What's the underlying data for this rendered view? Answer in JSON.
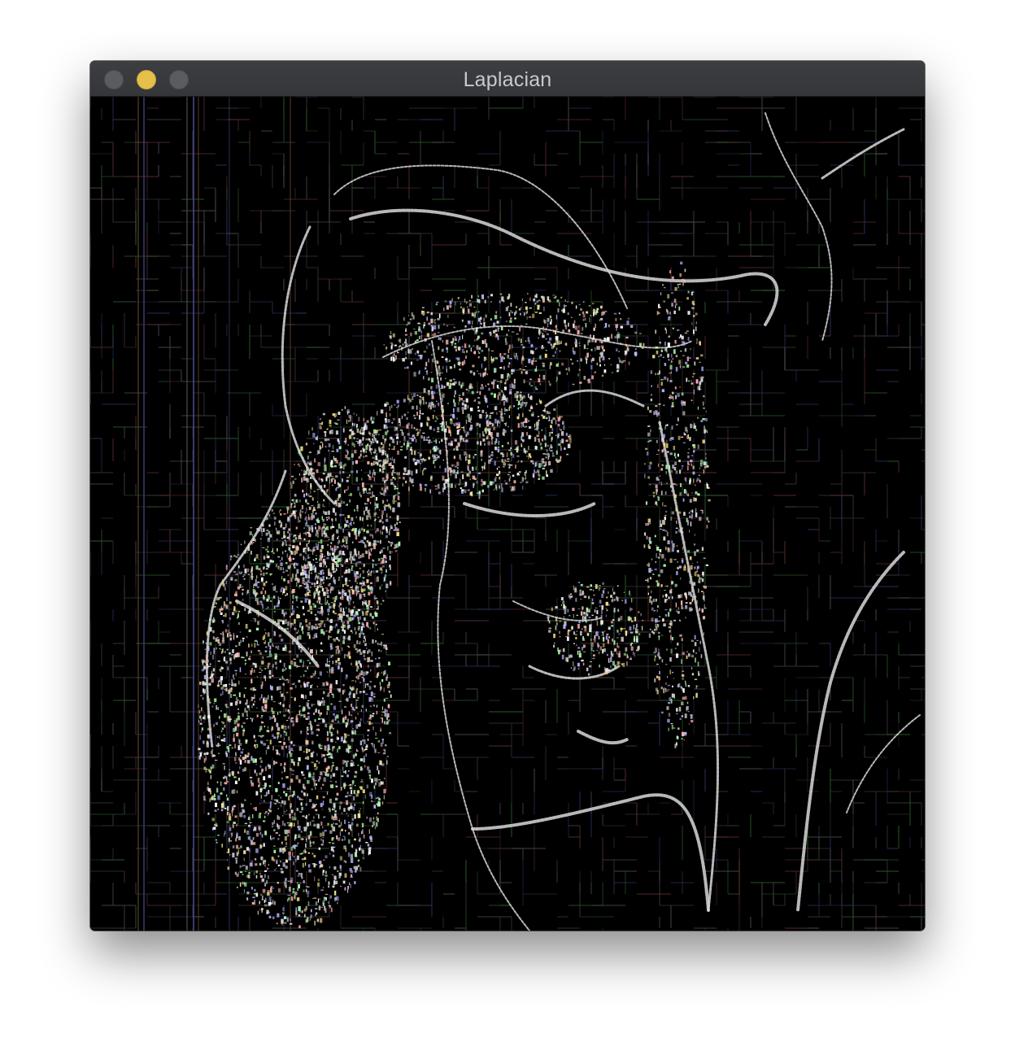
{
  "window": {
    "title": "Laplacian",
    "buttons": {
      "close": "close-button",
      "minimize": "minimize-button",
      "zoom": "zoom-button"
    },
    "colors": {
      "titlebar": "#3a3b3e",
      "minimize": "#e5c04a",
      "inactive_button": "#5b5c5f",
      "title_text": "#c9c9cc"
    }
  },
  "image": {
    "description_tag": "laplacian-edge-filtered-image",
    "background": "#000000"
  }
}
